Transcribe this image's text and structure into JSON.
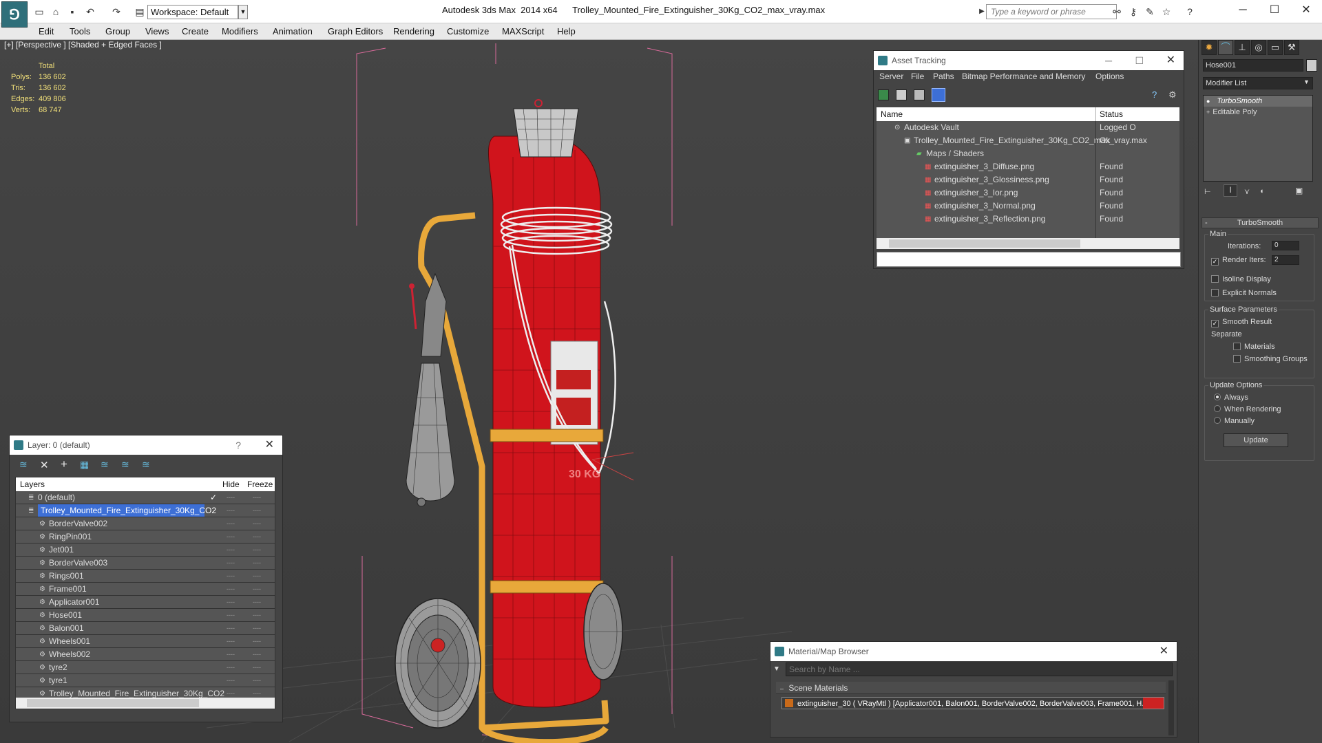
{
  "titlebar": {
    "workspace": "Workspace: Default",
    "app_title": "Autodesk 3ds Max  2014 x64      Trolley_Mounted_Fire_Extinguisher_30Kg_CO2_max_vray.max",
    "search_placeholder": "Type a keyword or phrase",
    "minimize": "─",
    "maximize": "☐",
    "close": "✕"
  },
  "menu": {
    "items": [
      "Edit",
      "Tools",
      "Group",
      "Views",
      "Create",
      "Modifiers",
      "Animation",
      "Graph Editors",
      "Rendering",
      "Customize",
      "MAXScript",
      "Help"
    ]
  },
  "viewport": {
    "label": "[+] [Perspective ] [Shaded + Edged Faces ]",
    "stats": {
      "header": "Total",
      "polys_label": "Polys:",
      "polys": "136 602",
      "tris_label": "Tris:",
      "tris": "136 602",
      "edges_label": "Edges:",
      "edges": "409 806",
      "verts_label": "Verts:",
      "verts": "68 747"
    },
    "tank_label": "30 KG"
  },
  "asset_tracking": {
    "title": "Asset Tracking",
    "menu": [
      "Server",
      "File",
      "Paths",
      "Bitmap Performance and Memory",
      "Options"
    ],
    "col_name": "Name",
    "col_status": "Status",
    "rows": [
      {
        "name": "Autodesk Vault",
        "status": "Logged O"
      },
      {
        "name": "Trolley_Mounted_Fire_Extinguisher_30Kg_CO2_max_vray.max",
        "status": "Ok"
      },
      {
        "name": "Maps / Shaders",
        "status": ""
      },
      {
        "name": "extinguisher_3_Diffuse.png",
        "status": "Found"
      },
      {
        "name": "extinguisher_3_Glossiness.png",
        "status": "Found"
      },
      {
        "name": "extinguisher_3_Ior.png",
        "status": "Found"
      },
      {
        "name": "extinguisher_3_Normal.png",
        "status": "Found"
      },
      {
        "name": "extinguisher_3_Reflection.png",
        "status": "Found"
      }
    ]
  },
  "layer_panel": {
    "title": "Layer: 0 (default)",
    "help": "?",
    "col_layers": "Layers",
    "col_hide": "Hide",
    "col_freeze": "Freeze",
    "rows": [
      {
        "name": "0 (default)",
        "selected": false
      },
      {
        "name": "Trolley_Mounted_Fire_Extinguisher_30Kg_CO2",
        "selected": true
      },
      {
        "name": "BorderValve002"
      },
      {
        "name": "RingPin001"
      },
      {
        "name": "Jet001"
      },
      {
        "name": "BorderValve003"
      },
      {
        "name": "Rings001"
      },
      {
        "name": "Frame001"
      },
      {
        "name": "Applicator001"
      },
      {
        "name": "Hose001"
      },
      {
        "name": "Balon001"
      },
      {
        "name": "Wheels001"
      },
      {
        "name": "Wheels002"
      },
      {
        "name": "tyre2"
      },
      {
        "name": "tyre1"
      },
      {
        "name": "Trolley_Mounted_Fire_Extinguisher_30Kg_CO2"
      }
    ],
    "dash": "----"
  },
  "material_browser": {
    "title": "Material/Map Browser",
    "search_placeholder": "Search by Name ...",
    "section": "Scene Materials",
    "item": "extinguisher_30  ( VRayMtl ) [Applicator001, Balon001, BorderValve002, BorderValve003, Frame001, H..."
  },
  "command_panel": {
    "object_name": "Hose001",
    "modifier_list": "Modifier List",
    "stack": [
      "TurboSmooth",
      "Editable Poly"
    ],
    "rollout_title": "TurboSmooth",
    "main": "Main",
    "iterations_label": "Iterations:",
    "iterations": "0",
    "render_iters_label": "Render Iters:",
    "render_iters": "2",
    "isoline": "Isoline Display",
    "explicit_normals": "Explicit Normals",
    "surface_params": "Surface Parameters",
    "smooth_result": "Smooth Result",
    "separate": "Separate",
    "materials": "Materials",
    "smoothing_groups": "Smoothing Groups",
    "update_options": "Update Options",
    "always": "Always",
    "when_rendering": "When Rendering",
    "manually": "Manually",
    "update_button": "Update"
  },
  "colors": {
    "tank_red": "#d0141c",
    "frame_yellow": "#e8a83a",
    "selection_blue": "#3d6fd6",
    "stats_yellow": "#f4e27a"
  }
}
